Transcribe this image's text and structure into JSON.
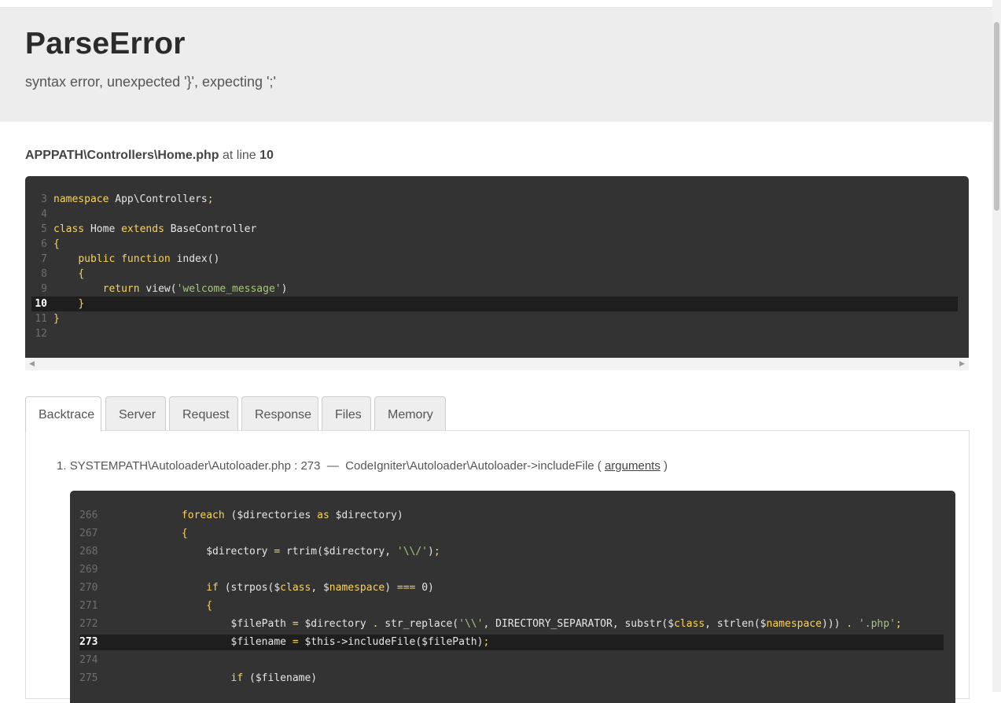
{
  "header": {
    "title": "ParseError",
    "message": "syntax error, unexpected '}', expecting ';'"
  },
  "location": {
    "file": "APPPATH\\Controllers\\Home.php",
    "at_text": "at line",
    "line": "10"
  },
  "source": {
    "lines": [
      {
        "num": "3",
        "text": "namespace App\\Controllers;"
      },
      {
        "num": "4",
        "text": ""
      },
      {
        "num": "5",
        "text": "class Home extends BaseController"
      },
      {
        "num": "6",
        "text": "{"
      },
      {
        "num": "7",
        "text": "    public function index()"
      },
      {
        "num": "8",
        "text": "    {"
      },
      {
        "num": "9",
        "text": "        return view('welcome_message')"
      },
      {
        "num": "10",
        "text": "    }"
      },
      {
        "num": "11",
        "text": "}"
      },
      {
        "num": "12",
        "text": ""
      }
    ],
    "highlight_line": "10"
  },
  "tabs": [
    {
      "label": "Backtrace",
      "active": true
    },
    {
      "label": "Server",
      "active": false
    },
    {
      "label": "Request",
      "active": false
    },
    {
      "label": "Response",
      "active": false
    },
    {
      "label": "Files",
      "active": false
    },
    {
      "label": "Memory",
      "active": false
    }
  ],
  "backtrace": {
    "item_number": "1.",
    "file": "SYSTEMPATH\\Autoloader\\Autoloader.php : 273",
    "separator": "—",
    "function": "CodeIgniter\\Autoloader\\Autoloader->includeFile (",
    "arguments_label": "arguments",
    "close": ")",
    "lines": [
      {
        "num": "266",
        "text": "            foreach ($directories as $directory)"
      },
      {
        "num": "267",
        "text": "            {"
      },
      {
        "num": "268",
        "text": "                $directory = rtrim($directory, '\\\\/');"
      },
      {
        "num": "269",
        "text": ""
      },
      {
        "num": "270",
        "text": "                if (strpos($class, $namespace) === 0)"
      },
      {
        "num": "271",
        "text": "                {"
      },
      {
        "num": "272",
        "text": "                    $filePath = $directory . str_replace('\\\\', DIRECTORY_SEPARATOR, substr($class, strlen($namespace))) . '.php';"
      },
      {
        "num": "273",
        "text": "                    $filename = $this->includeFile($filePath);"
      },
      {
        "num": "274",
        "text": ""
      },
      {
        "num": "275",
        "text": "                    if ($filename)"
      }
    ],
    "highlight_line": "273"
  },
  "colors": {
    "code_bg": "#333333",
    "highlight_bg": "#1e1e1e",
    "keyword": "#f8d45c",
    "string": "#a6c77c",
    "header_bg": "#ededed"
  }
}
